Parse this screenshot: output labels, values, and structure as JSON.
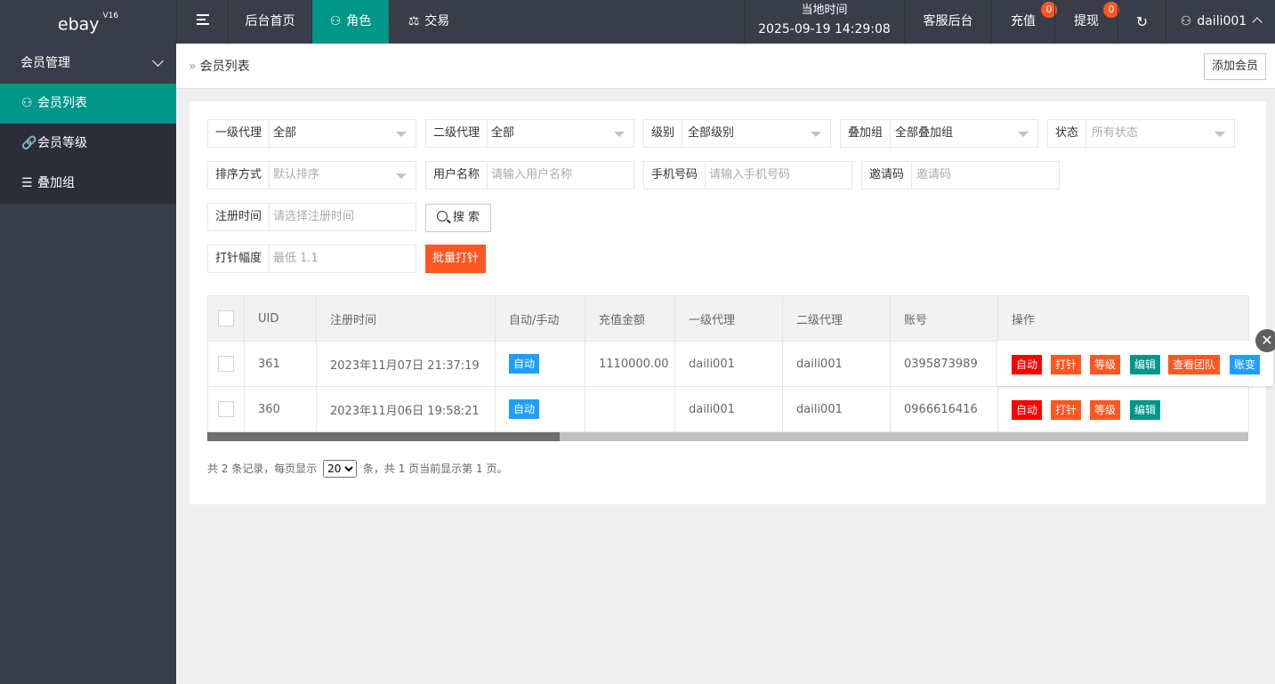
{
  "header": {
    "logo": "ebay",
    "logo_version": "V16",
    "nav": [
      "后台首页",
      "角色",
      "交易"
    ],
    "time_label": "当地时间",
    "time_value": "2025-09-19 14:29:08",
    "service": "客服后台",
    "recharge": "充值",
    "recharge_count": "0",
    "withdraw": "提现",
    "withdraw_count": "0",
    "user": "daili001"
  },
  "sidebar": {
    "group": "会员管理",
    "items": [
      "会员列表",
      "会员等级",
      "叠加组"
    ]
  },
  "breadcrumb": {
    "current": "会员列表",
    "add_button": "添加会员"
  },
  "filters": {
    "agent1": {
      "label": "一级代理",
      "value": "全部"
    },
    "agent2": {
      "label": "二级代理",
      "value": "全部"
    },
    "level": {
      "label": "级别",
      "value": "全部级别"
    },
    "group": {
      "label": "叠加组",
      "value": "全部叠加组"
    },
    "status": {
      "label": "状态",
      "placeholder": "所有状态"
    },
    "sort": {
      "label": "排序方式",
      "placeholder": "默认排序"
    },
    "username": {
      "label": "用户名称",
      "placeholder": "请输入用户名称"
    },
    "phone": {
      "label": "手机号码",
      "placeholder": "请输入手机号码"
    },
    "invite": {
      "label": "邀请码",
      "placeholder": "邀请码"
    },
    "regtime": {
      "label": "注册时间",
      "placeholder": "请选择注册时间"
    },
    "search_button": "搜 索",
    "needle": {
      "label": "打针幅度",
      "placeholder": "最低 1.1"
    },
    "batch_button": "批量打针"
  },
  "table": {
    "headers": [
      "UID",
      "注册时间",
      "自动/手动",
      "充值金额",
      "一级代理",
      "二级代理",
      "账号",
      "操作"
    ],
    "rows": [
      {
        "uid": "361",
        "time": "2023年11月07日 21:37:19",
        "mode": "自动",
        "amount": "1110000.00",
        "agent1": "daili001",
        "agent2": "daili001",
        "account": "0395873989"
      },
      {
        "uid": "360",
        "time": "2023年11月06日 19:58:21",
        "mode": "自动",
        "amount": "",
        "agent1": "daili001",
        "agent2": "daili001",
        "account": "0966616416"
      }
    ],
    "ops_row1": [
      "自动",
      "打针",
      "等级",
      "编辑",
      "查看团队",
      "账变"
    ],
    "ops_row2": [
      "自动",
      "打针",
      "等级",
      "编辑"
    ]
  },
  "pager": {
    "prefix": "共 2 条记录，每页显示",
    "page_size": "20",
    "suffix": "条，共 1 页当前显示第 1 页。"
  },
  "colors": {
    "accent": "#009688",
    "orange": "#ff5722",
    "red": "#ff0000",
    "blue": "#1e9fff",
    "dark": "#393d49"
  }
}
